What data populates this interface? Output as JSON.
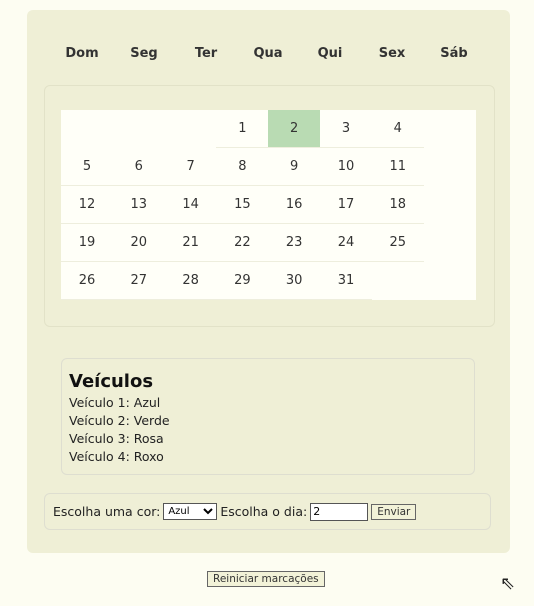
{
  "weekdays": [
    "Dom",
    "Seg",
    "Ter",
    "Qua",
    "Qui",
    "Sex",
    "Sáb"
  ],
  "calendar": {
    "first_weekday": 3,
    "days": 31,
    "selected_day": 2,
    "selected_color": "#b9dbb3"
  },
  "vehicles": {
    "title": "Veículos",
    "items": [
      "Veículo 1: Azul",
      "Veículo 2: Verde",
      "Veículo 3: Rosa",
      "Veículo 4: Roxo"
    ]
  },
  "form": {
    "color_label": "Escolha uma cor:",
    "color_value": "Azul",
    "day_label": "Escolha o dia:",
    "day_value": "2",
    "submit": "Enviar"
  },
  "reset_label": "Reiniciar marcações"
}
